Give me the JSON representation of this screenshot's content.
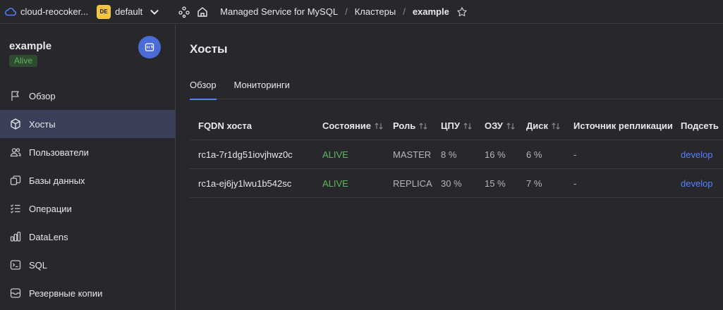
{
  "topbar": {
    "cloud_name": "cloud-reocoker...",
    "folder_badge": "DE",
    "folder_name": "default",
    "breadcrumbs": [
      "Managed Service for MySQL",
      "Кластеры",
      "example"
    ]
  },
  "sidebar": {
    "cluster_name": "example",
    "status": "Alive",
    "items": [
      {
        "label": "Обзор",
        "icon": "flag-icon"
      },
      {
        "label": "Хосты",
        "icon": "cube-icon"
      },
      {
        "label": "Пользователи",
        "icon": "users-icon"
      },
      {
        "label": "Базы данных",
        "icon": "databases-icon"
      },
      {
        "label": "Операции",
        "icon": "operations-icon"
      },
      {
        "label": "DataLens",
        "icon": "chart-icon"
      },
      {
        "label": "SQL",
        "icon": "terminal-icon"
      },
      {
        "label": "Резервные копии",
        "icon": "backup-icon"
      }
    ]
  },
  "main": {
    "title": "Хосты",
    "tabs": [
      "Обзор",
      "Мониторинги"
    ],
    "table": {
      "headers": [
        "FQDN хоста",
        "Состояние",
        "Роль",
        "ЦПУ",
        "ОЗУ",
        "Диск",
        "Источник репликации",
        "Подсеть"
      ],
      "rows": [
        {
          "fqdn": "rc1a-7r1dg51iovjhwz0c",
          "state": "ALIVE",
          "role": "MASTER",
          "cpu": "8 %",
          "ram": "16 %",
          "disk": "6 %",
          "source": "-",
          "subnet": "develop"
        },
        {
          "fqdn": "rc1a-ej6jy1lwu1b542sc",
          "state": "ALIVE",
          "role": "REPLICA",
          "cpu": "30 %",
          "ram": "15 %",
          "disk": "7 %",
          "source": "-",
          "subnet": "develop"
        }
      ]
    }
  },
  "colors": {
    "accent": "#5282ff",
    "alive": "#5cb85c",
    "folder_badge": "#f4c542",
    "background": "#28272c"
  }
}
